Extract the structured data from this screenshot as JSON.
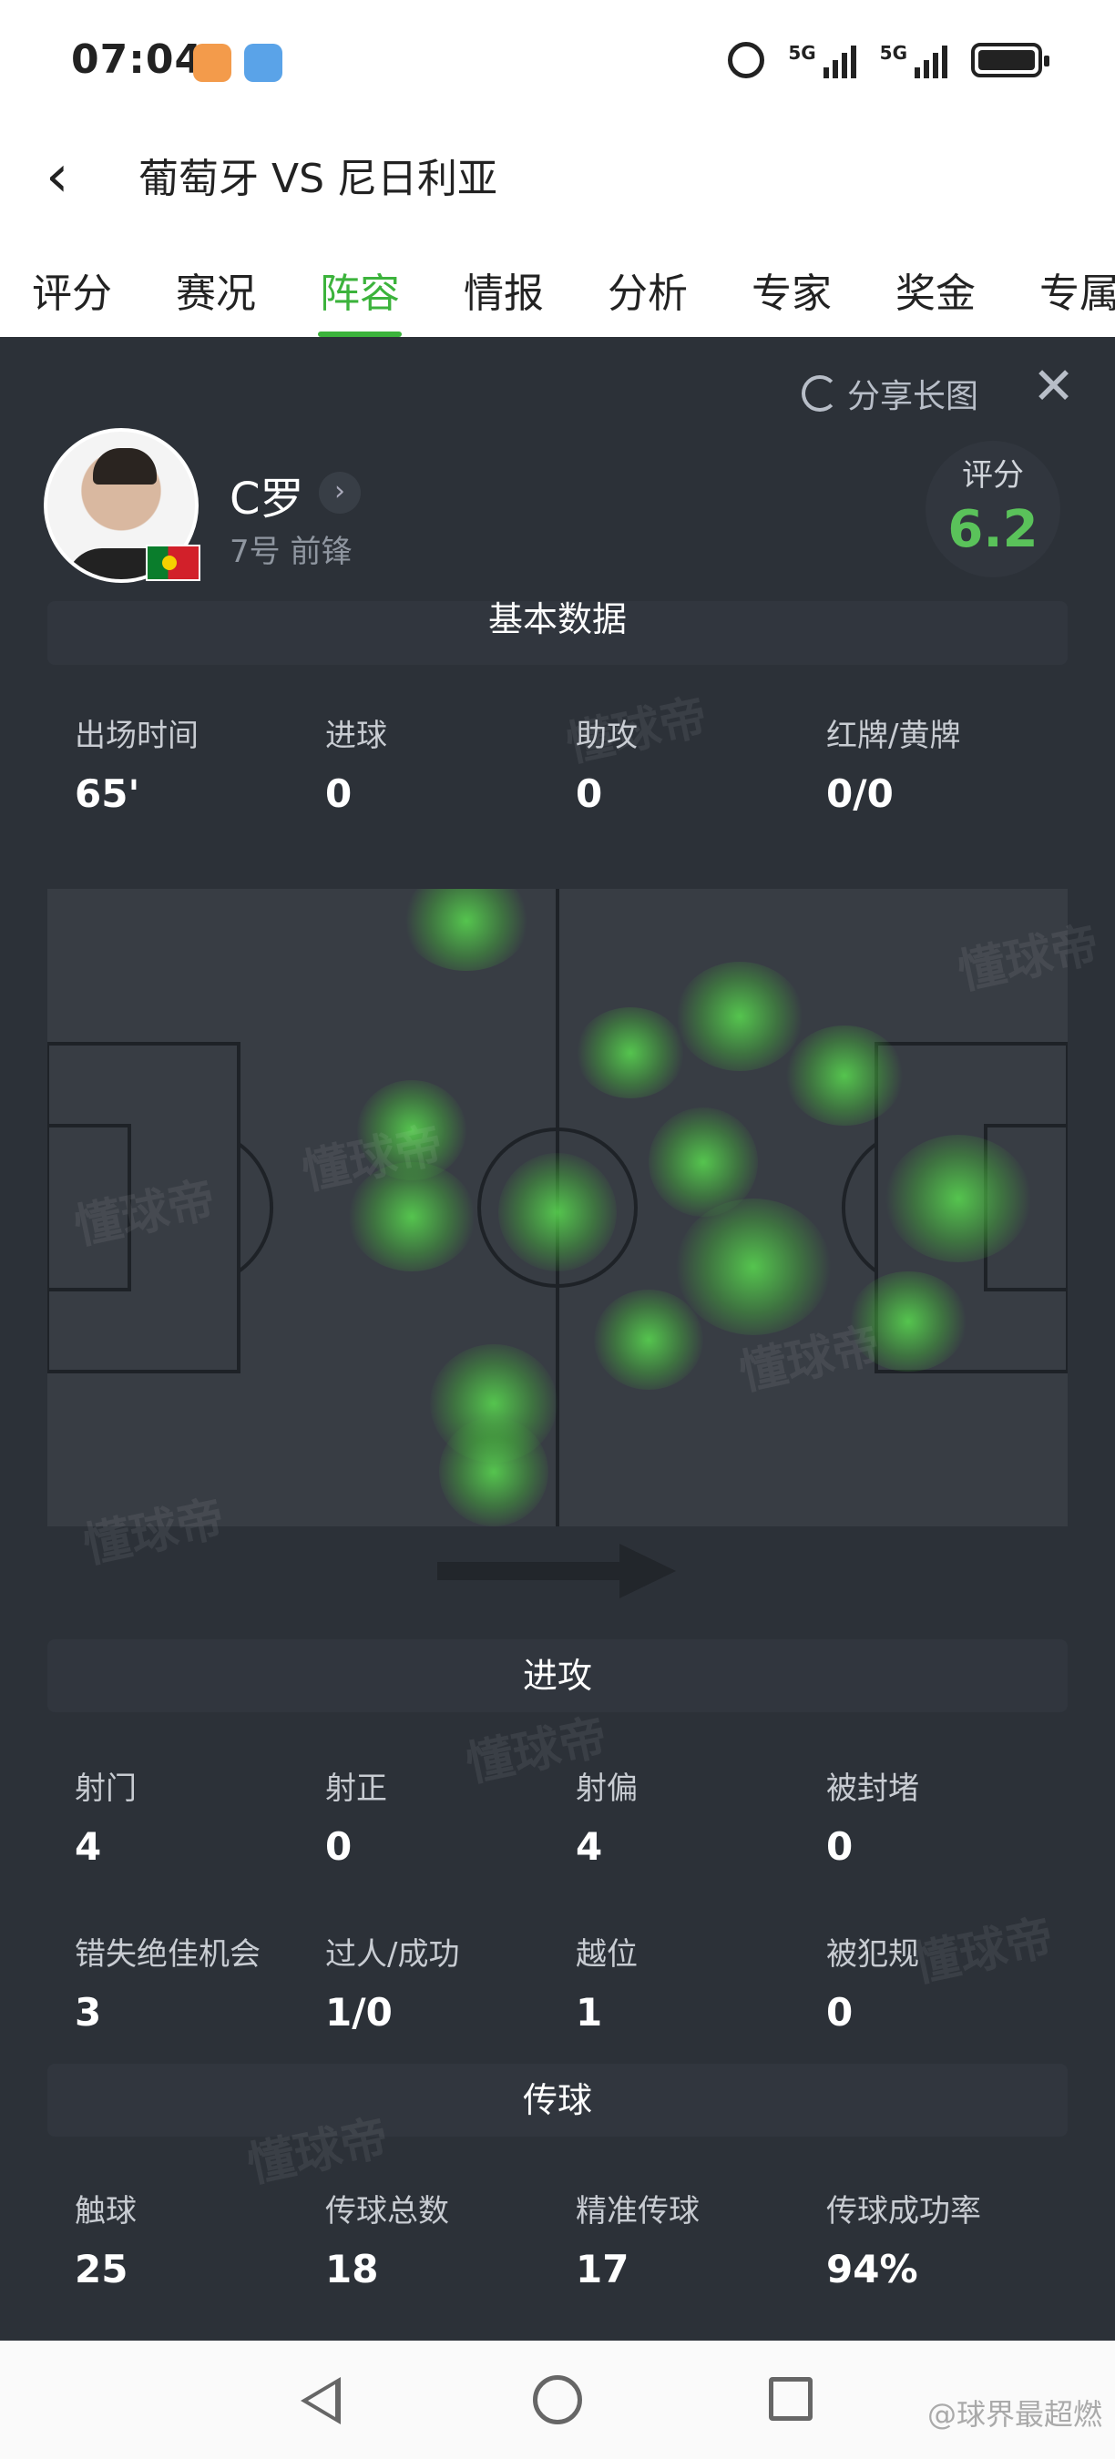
{
  "status": {
    "time": "07:04",
    "signal1": "5G",
    "signal2": "5G"
  },
  "header": {
    "back_icon": "chevron-left-icon",
    "title": "葡萄牙 VS 尼日利亚",
    "tabs": [
      {
        "label": "评分"
      },
      {
        "label": "赛况"
      },
      {
        "label": "阵容"
      },
      {
        "label": "情报"
      },
      {
        "label": "分析"
      },
      {
        "label": "专家"
      },
      {
        "label": "奖金"
      },
      {
        "label": "专属"
      }
    ],
    "active_tab": "阵容"
  },
  "toolbar": {
    "share_label": "分享长图",
    "close_icon": "close-icon"
  },
  "player": {
    "name": "C罗",
    "info": "7号 前锋",
    "score_label": "评分",
    "score": "6.2",
    "score_color": "#5ac25a"
  },
  "basic": {
    "title": "基本数据",
    "stats": [
      {
        "label": "出场时间",
        "value": "65'"
      },
      {
        "label": "进球",
        "value": "0"
      },
      {
        "label": "助攻",
        "value": "0"
      },
      {
        "label": "红牌/黄牌",
        "value": "0/0"
      }
    ]
  },
  "heatmap": {
    "direction_icon": "arrow-right-icon",
    "accent": "#5adc50"
  },
  "attack": {
    "title": "进攻",
    "row1": [
      {
        "label": "射门",
        "value": "4"
      },
      {
        "label": "射正",
        "value": "0"
      },
      {
        "label": "射偏",
        "value": "4"
      },
      {
        "label": "被封堵",
        "value": "0"
      }
    ],
    "row2": [
      {
        "label": "错失绝佳机会",
        "value": "3"
      },
      {
        "label": "过人/成功",
        "value": "1/0"
      },
      {
        "label": "越位",
        "value": "1"
      },
      {
        "label": "被犯规",
        "value": "0"
      }
    ]
  },
  "passing": {
    "title": "传球",
    "stats": [
      {
        "label": "触球",
        "value": "25"
      },
      {
        "label": "传球总数",
        "value": "18"
      },
      {
        "label": "精准传球",
        "value": "17"
      },
      {
        "label": "传球成功率",
        "value": "94%"
      }
    ]
  },
  "watermark": "懂球帝",
  "footer": {
    "credit": "@球界最超燃"
  }
}
